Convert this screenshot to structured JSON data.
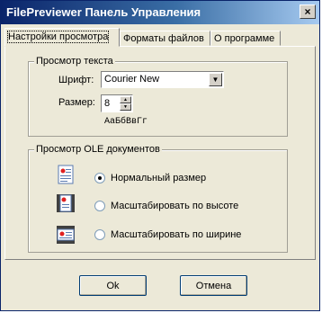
{
  "window": {
    "title": "FilePreviewer Панель Управления",
    "close_label": "×"
  },
  "tabs": [
    {
      "label": "Настройки просмотра",
      "active": true
    },
    {
      "label": "Форматы файлов",
      "active": false
    },
    {
      "label": "О программе",
      "active": false
    }
  ],
  "text_preview": {
    "group_label": "Просмотр текста",
    "font_label": "Шрифт:",
    "font_value": "Courier New",
    "size_label": "Размер:",
    "size_value": "8",
    "sample_text": "АаБбВвГг"
  },
  "ole_preview": {
    "group_label": "Просмотр OLE документов",
    "options": [
      {
        "label": "Нормальный размер",
        "icon": "normal-size-icon",
        "selected": true
      },
      {
        "label": "Масштабировать по высоте",
        "icon": "fit-height-icon",
        "selected": false
      },
      {
        "label": "Масштабировать по ширине",
        "icon": "fit-width-icon",
        "selected": false
      }
    ]
  },
  "buttons": {
    "ok_label": "Ok",
    "cancel_label": "Отмена"
  },
  "colors": {
    "title_bar": "#0a246a",
    "window_bg": "#ece9d8"
  }
}
